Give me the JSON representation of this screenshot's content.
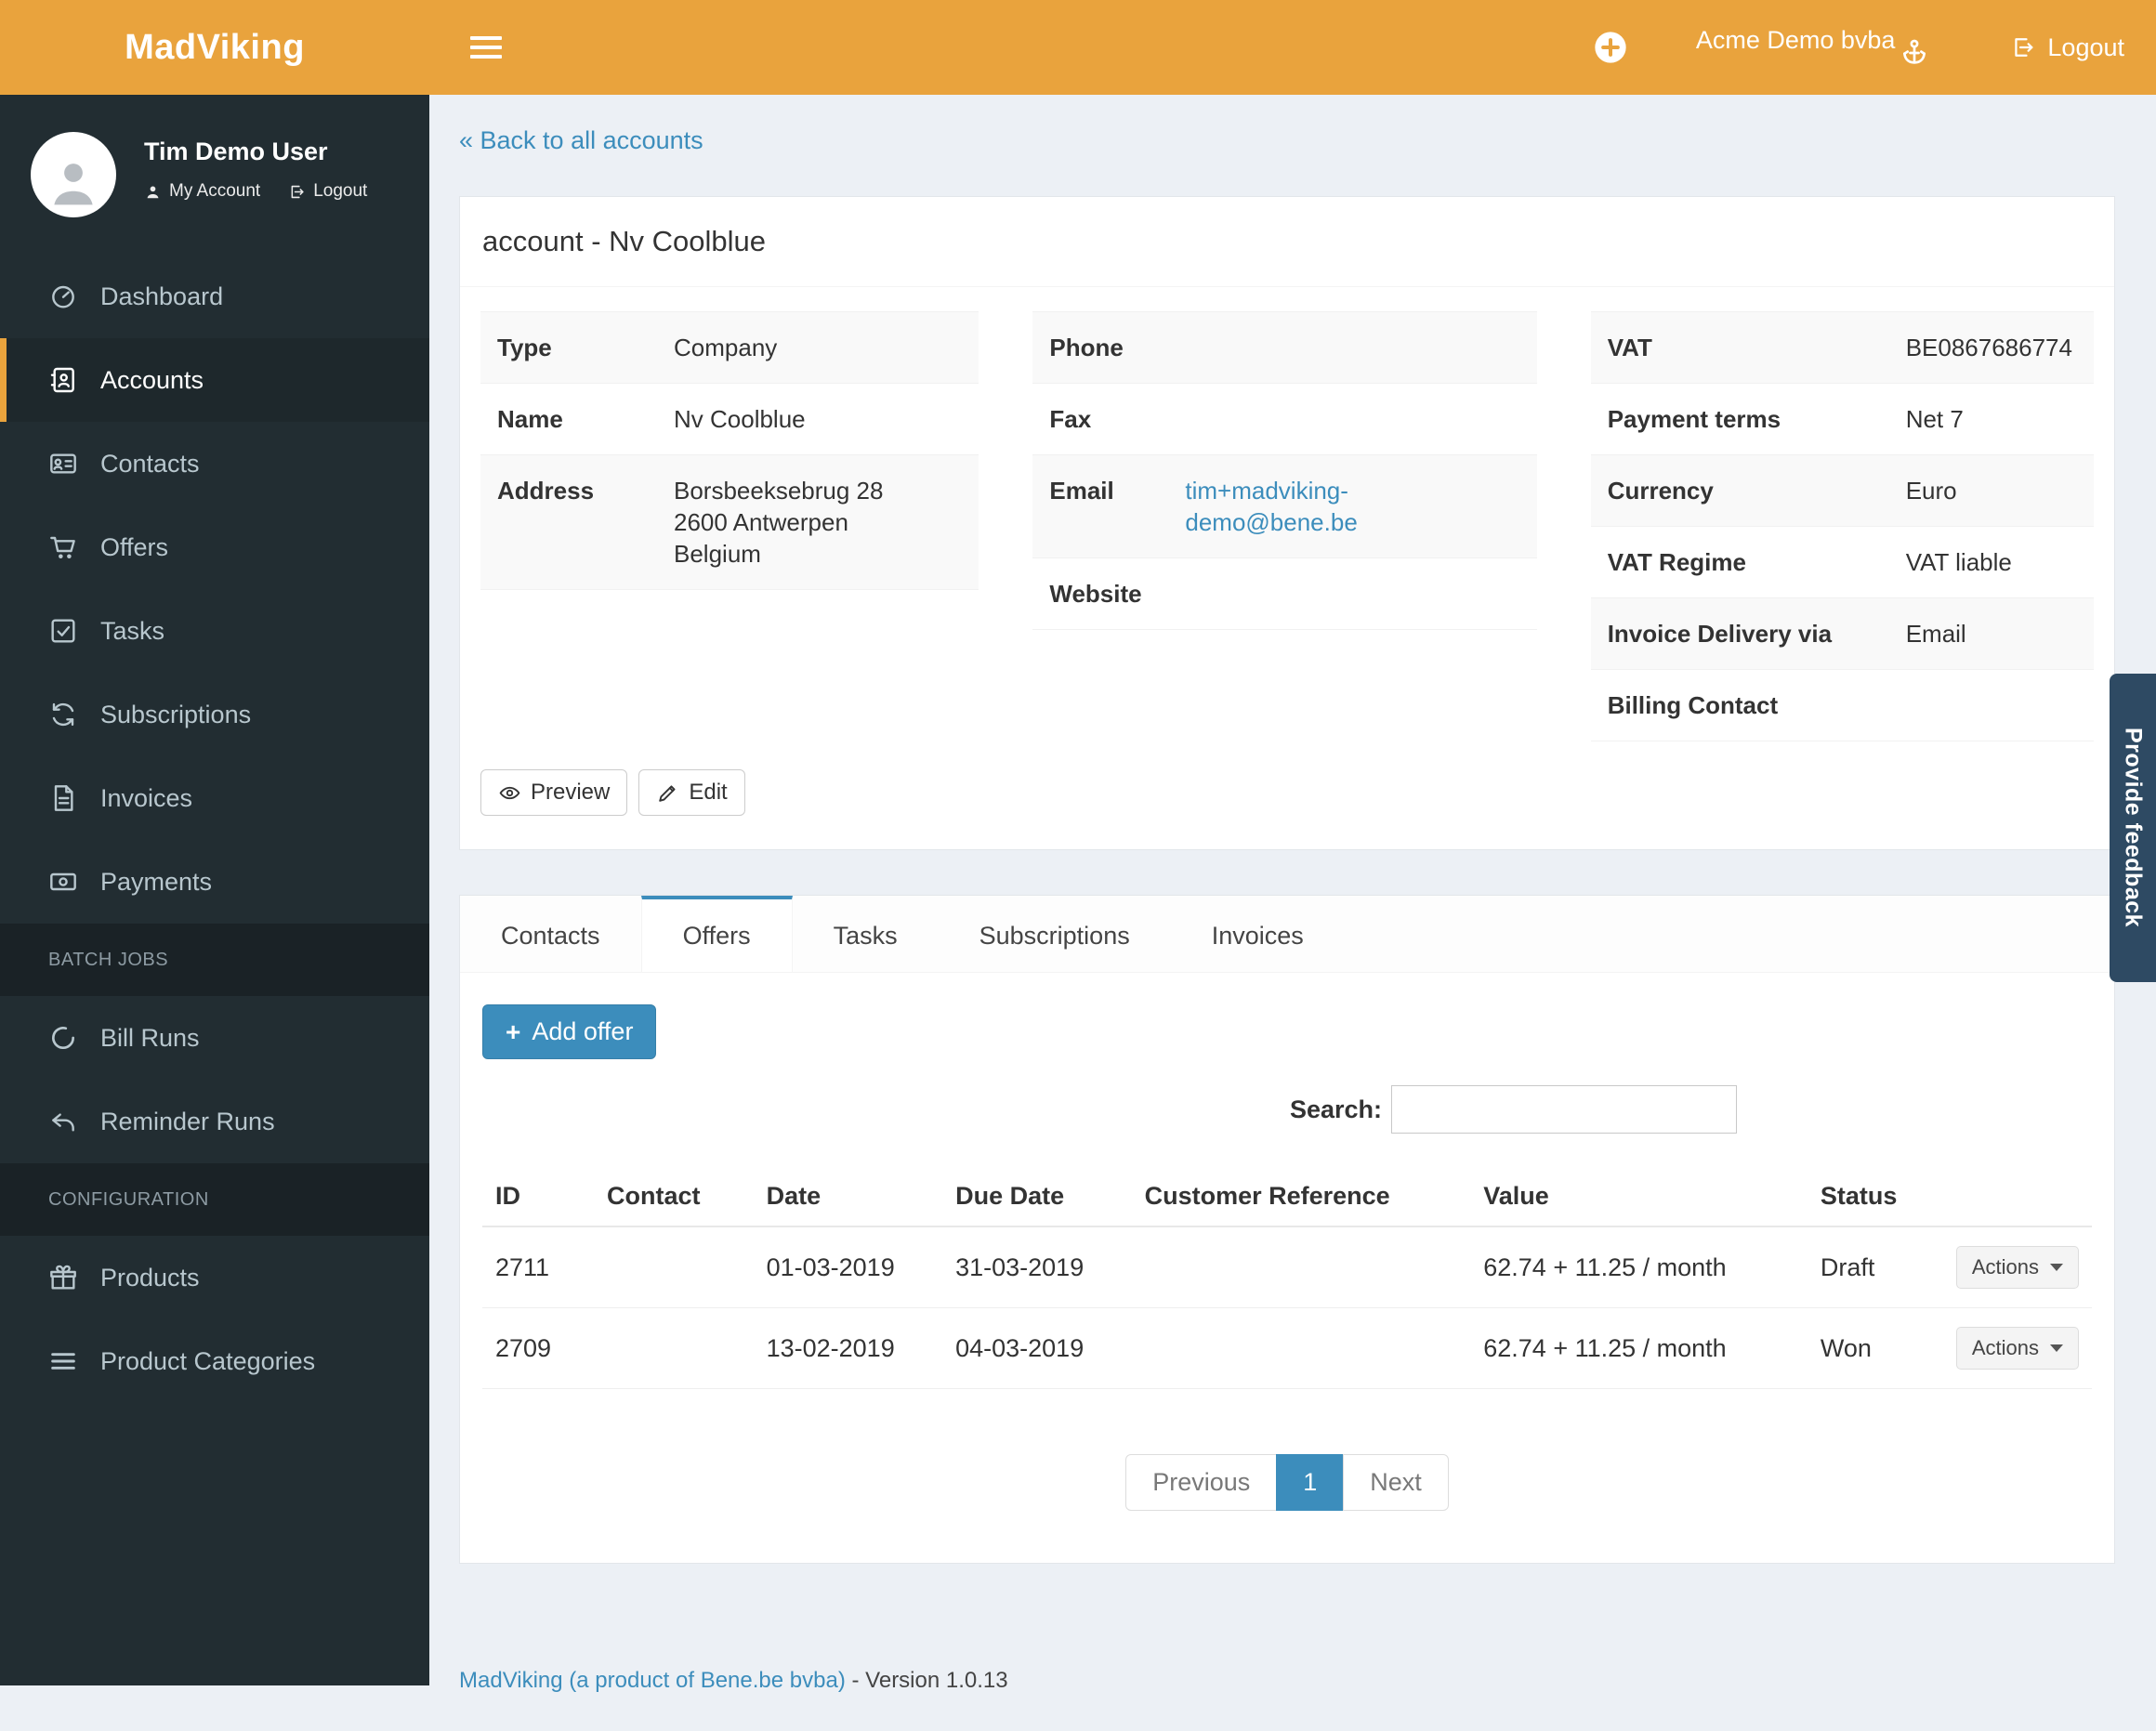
{
  "navbar": {
    "brand": "MadViking",
    "account_name": "Acme Demo bvba",
    "logout_label": "Logout"
  },
  "sidebar": {
    "user": {
      "name": "Tim Demo User",
      "my_account_label": "My Account",
      "logout_label": "Logout"
    },
    "items": [
      {
        "label": "Dashboard",
        "icon": "dashboard-icon",
        "active": false
      },
      {
        "label": "Accounts",
        "icon": "accounts-icon",
        "active": true
      },
      {
        "label": "Contacts",
        "icon": "contacts-icon",
        "active": false
      },
      {
        "label": "Offers",
        "icon": "cart-icon",
        "active": false
      },
      {
        "label": "Tasks",
        "icon": "tasks-icon",
        "active": false
      },
      {
        "label": "Subscriptions",
        "icon": "refresh-icon",
        "active": false
      },
      {
        "label": "Invoices",
        "icon": "invoice-icon",
        "active": false
      },
      {
        "label": "Payments",
        "icon": "payments-icon",
        "active": false
      }
    ],
    "batch_header": "BATCH JOBS",
    "batch_items": [
      {
        "label": "Bill Runs",
        "icon": "bill-runs-icon"
      },
      {
        "label": "Reminder Runs",
        "icon": "reminder-icon"
      }
    ],
    "config_header": "CONFIGURATION",
    "config_items": [
      {
        "label": "Products",
        "icon": "products-icon"
      },
      {
        "label": "Product Categories",
        "icon": "categories-icon"
      }
    ]
  },
  "main": {
    "back_link": "« Back to all accounts",
    "panel_title": "account - Nv Coolblue",
    "general": [
      {
        "label": "Type",
        "value": "Company"
      },
      {
        "label": "Name",
        "value": "Nv Coolblue"
      },
      {
        "label": "Address",
        "value": "Borsbeeksebrug 28\n2600 Antwerpen\nBelgium"
      }
    ],
    "contact": [
      {
        "label": "Phone",
        "value": ""
      },
      {
        "label": "Fax",
        "value": ""
      },
      {
        "label": "Email",
        "value": "tim+madviking-demo@bene.be"
      },
      {
        "label": "Website",
        "value": ""
      }
    ],
    "billing": [
      {
        "label": "VAT",
        "value": "BE0867686774"
      },
      {
        "label": "Payment terms",
        "value": "Net 7"
      },
      {
        "label": "Currency",
        "value": "Euro"
      },
      {
        "label": "VAT Regime",
        "value": "VAT liable"
      },
      {
        "label": "Invoice Delivery via",
        "value": "Email"
      },
      {
        "label": "Billing Contact",
        "value": ""
      }
    ],
    "preview_button": "Preview",
    "edit_button": "Edit",
    "tabs": [
      {
        "label": "Contacts",
        "active": false
      },
      {
        "label": "Offers",
        "active": true
      },
      {
        "label": "Tasks",
        "active": false
      },
      {
        "label": "Subscriptions",
        "active": false
      },
      {
        "label": "Invoices",
        "active": false
      }
    ],
    "offers": {
      "add_button": "Add offer",
      "search_label": "Search:",
      "headers": [
        "ID",
        "Contact",
        "Date",
        "Due Date",
        "Customer Reference",
        "Value",
        "Status",
        ""
      ],
      "rows": [
        {
          "id": "2711",
          "contact": "",
          "date": "01-03-2019",
          "due_date": "31-03-2019",
          "customer_reference": "",
          "value": "62.74 + 11.25 / month",
          "status": "Draft",
          "actions_label": "Actions"
        },
        {
          "id": "2709",
          "contact": "",
          "date": "13-02-2019",
          "due_date": "04-03-2019",
          "customer_reference": "",
          "value": "62.74 + 11.25 / month",
          "status": "Won",
          "actions_label": "Actions"
        }
      ],
      "pagination": {
        "previous": "Previous",
        "current": "1",
        "next": "Next"
      }
    }
  },
  "footer": {
    "link": "MadViking (a product of Bene.be bvba)",
    "suffix": "- Version 1.0.13"
  },
  "feedback_tab": "Provide feedback",
  "colors": {
    "navbar_orange": "#e9a33d",
    "sidebar_dark": "#222d32",
    "accent_blue": "#3c8dbc",
    "content_bg": "#ecf0f5"
  }
}
